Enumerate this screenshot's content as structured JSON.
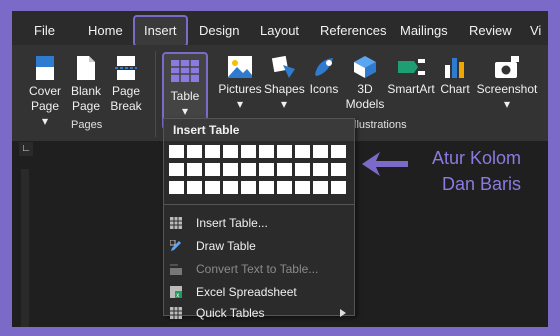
{
  "menubar": {
    "tabs": [
      {
        "label": "File"
      },
      {
        "label": "Home"
      },
      {
        "label": "Insert"
      },
      {
        "label": "Design"
      },
      {
        "label": "Layout"
      },
      {
        "label": "References"
      },
      {
        "label": "Mailings"
      },
      {
        "label": "Review"
      },
      {
        "label": "Vi"
      }
    ]
  },
  "ribbon": {
    "buttons": [
      {
        "line1": "Cover",
        "line2": "Page ▾"
      },
      {
        "line1": "Blank",
        "line2": "Page"
      },
      {
        "line1": "Page",
        "line2": "Break"
      },
      {
        "line1": "Table",
        "line2": "▾"
      },
      {
        "line1": "Pictures",
        "line2": "▾"
      },
      {
        "line1": "Shapes",
        "line2": "▾"
      },
      {
        "line1": "Icons",
        "line2": ""
      },
      {
        "line1": "3D",
        "line2": "Models"
      },
      {
        "line1": "SmartArt",
        "line2": ""
      },
      {
        "line1": "Chart",
        "line2": ""
      },
      {
        "line1": "Screenshot",
        "line2": "▾"
      }
    ],
    "groups": [
      {
        "label": "Pages"
      },
      {
        "label": "llustrations"
      }
    ]
  },
  "ruler_corner": "∟",
  "dropdown": {
    "header": "Insert Table",
    "items": [
      {
        "label": "Insert Table...",
        "enabled": true,
        "icon": "table-icon"
      },
      {
        "label": "Draw Table",
        "enabled": true,
        "icon": "pencil-icon"
      },
      {
        "label": "Convert Text to Table...",
        "enabled": false,
        "icon": "convert-icon"
      },
      {
        "label": "Excel Spreadsheet",
        "enabled": true,
        "icon": "excel-icon"
      },
      {
        "label": "Quick Tables",
        "enabled": true,
        "icon": "table-icon"
      }
    ]
  },
  "annotation": {
    "line1": "Atur Kolom",
    "line2": "Dan Baris"
  },
  "colors": {
    "accent": "#7b6ac7",
    "annotation": "#8b7be0"
  }
}
